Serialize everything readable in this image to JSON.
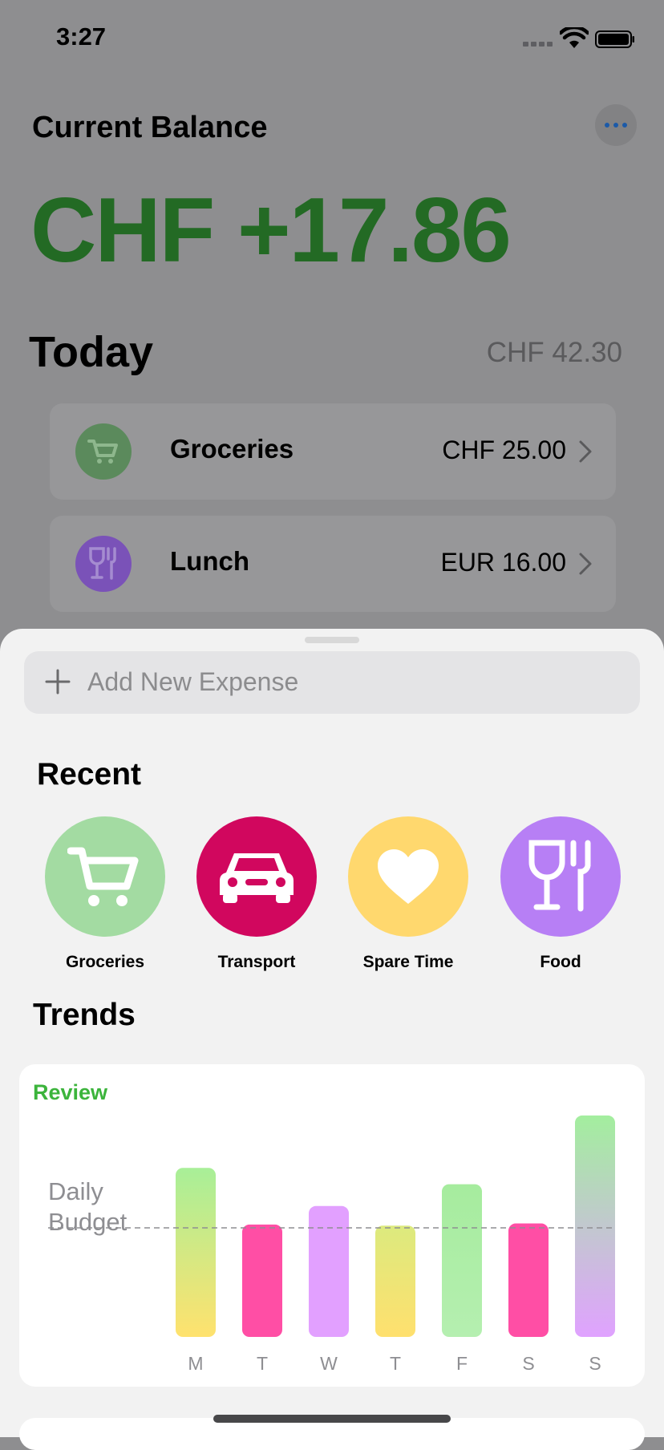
{
  "status": {
    "time": "3:27"
  },
  "header": {
    "title": "Current Balance",
    "balance": "CHF +17.86",
    "balance_color": "#236a24"
  },
  "today": {
    "label": "Today",
    "total": "CHF 42.30",
    "items": [
      {
        "name": "Groceries",
        "amount": "CHF 25.00",
        "icon": "cart-icon",
        "color": "#5b8a5c"
      },
      {
        "name": "Lunch",
        "amount": "EUR 16.00",
        "icon": "food-icon",
        "color": "#7a52b8"
      }
    ]
  },
  "sheet": {
    "add_placeholder": "Add New Expense",
    "recent_label": "Recent",
    "recent": [
      {
        "label": "Groceries",
        "icon": "cart-icon",
        "color": "#a3dba2"
      },
      {
        "label": "Transport",
        "icon": "car-icon",
        "color": "#d1075e"
      },
      {
        "label": "Spare Time",
        "icon": "heart-icon",
        "color": "#ffd86e"
      },
      {
        "label": "Food",
        "icon": "food-icon",
        "color": "#b77ff5"
      }
    ],
    "trends_label": "Trends",
    "review_label": "Review",
    "budget_label_1": "Daily",
    "budget_label_2": "Budget"
  },
  "chart_data": {
    "type": "bar",
    "categories": [
      "M",
      "T",
      "W",
      "T",
      "F",
      "S",
      "S"
    ],
    "values": [
      1.55,
      1.03,
      1.2,
      1.02,
      1.4,
      1.04,
      2.03
    ],
    "budget_line": 1.0,
    "ylim": [
      0,
      2.1
    ],
    "bar_colors": [
      [
        "#a8ef98",
        "#ffe26e"
      ],
      [
        "#ff4ea5",
        "#ff4ea5"
      ],
      [
        "#e2a0ff",
        "#e2a0ff"
      ],
      [
        "#dcea7e",
        "#ffe06e"
      ],
      [
        "#a6ec9e",
        "#b5efb0"
      ],
      [
        "#ff4ea5",
        "#ff4ea5"
      ],
      [
        "#a3ee9e",
        "#e0a2ff"
      ]
    ]
  }
}
